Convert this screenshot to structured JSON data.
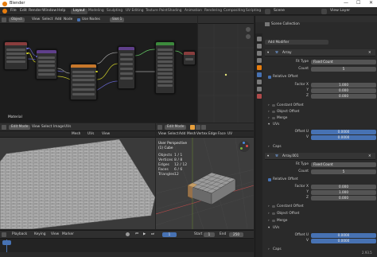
{
  "window": {
    "title": "Blender",
    "minimize": "—",
    "maximize": "☐",
    "close": "✕"
  },
  "menus": [
    "File",
    "Edit",
    "Render",
    "Window",
    "Help"
  ],
  "workspaces": [
    "Layout",
    "Modeling",
    "Sculpting",
    "UV Editing",
    "Texture Paint",
    "Shading",
    "Animation",
    "Rendering",
    "Compositing",
    "Scripting"
  ],
  "active_workspace": "Layout",
  "scene": {
    "name": "Scene",
    "view_layer": "View Layer"
  },
  "node_editor": {
    "object_label": "Object",
    "menus": [
      "View",
      "Select",
      "Add",
      "Node"
    ],
    "use_nodes": "Use Nodes",
    "slot": "Slot 1",
    "material_name": "Material"
  },
  "outliner": {
    "title": "Scene Collection"
  },
  "uv_editor": {
    "mode": "Edit Mode",
    "menus": [
      "View",
      "Select",
      "Image",
      "UVs"
    ],
    "mesh": "Mesh",
    "uvs": "UVs",
    "view": "View"
  },
  "viewport": {
    "mode": "Edit Mode",
    "menus": [
      "View",
      "Select",
      "Add",
      "Mesh",
      "Vertex",
      "Edge",
      "Face",
      "UV"
    ],
    "view_label": "User Perspective",
    "object_label": "(1) Cube",
    "stats": [
      {
        "k": "Objects",
        "v": "1 / 1"
      },
      {
        "k": "Vertices",
        "v": "8 / 8"
      },
      {
        "k": "Edges",
        "v": "12 / 12"
      },
      {
        "k": "Faces",
        "v": "6 / 6"
      },
      {
        "k": "Triangles",
        "v": "12"
      }
    ]
  },
  "properties": {
    "add_modifier": "Add Modifier",
    "modifiers": [
      {
        "name": "Array",
        "fit_type_label": "Fit Type",
        "fit_type": "Fixed Count",
        "count_label": "Count",
        "count": "5",
        "relative_offset": "Relative Offset",
        "factor": [
          {
            "k": "Factor X",
            "v": "1.000"
          },
          {
            "k": "Y",
            "v": "0.000"
          },
          {
            "k": "Z",
            "v": "0.000"
          }
        ],
        "options": [
          "Constant Offset",
          "Object Offset",
          "Merge"
        ],
        "uvs_label": "UVs",
        "offset_u_label": "Offset U",
        "offset_u": "0.0000",
        "v_label": "V",
        "offset_v": "0.0000",
        "caps": "Caps"
      },
      {
        "name": "Array.001",
        "fit_type_label": "Fit Type",
        "fit_type": "Fixed Count",
        "count_label": "Count",
        "count": "5",
        "relative_offset": "Relative Offset",
        "factor": [
          {
            "k": "Factor X",
            "v": "0.000"
          },
          {
            "k": "Y",
            "v": "1.000"
          },
          {
            "k": "Z",
            "v": "0.000"
          }
        ],
        "options": [
          "Constant Offset",
          "Object Offset",
          "Merge"
        ],
        "uvs_label": "UVs",
        "offset_u_label": "Offset U",
        "offset_u": "0.0000",
        "v_label": "V",
        "offset_v": "0.0000",
        "caps": "Caps"
      }
    ]
  },
  "timeline": {
    "menus": [
      "Playback",
      "Keying",
      "View",
      "Marker"
    ],
    "start_label": "Start",
    "start": "1",
    "end_label": "End",
    "end": "250",
    "current": "1"
  },
  "status": {
    "version": "2.93.5"
  },
  "colors": {
    "accent": "#4772b3",
    "orange": "#e87d0d",
    "bg": "#2b2b2b"
  }
}
